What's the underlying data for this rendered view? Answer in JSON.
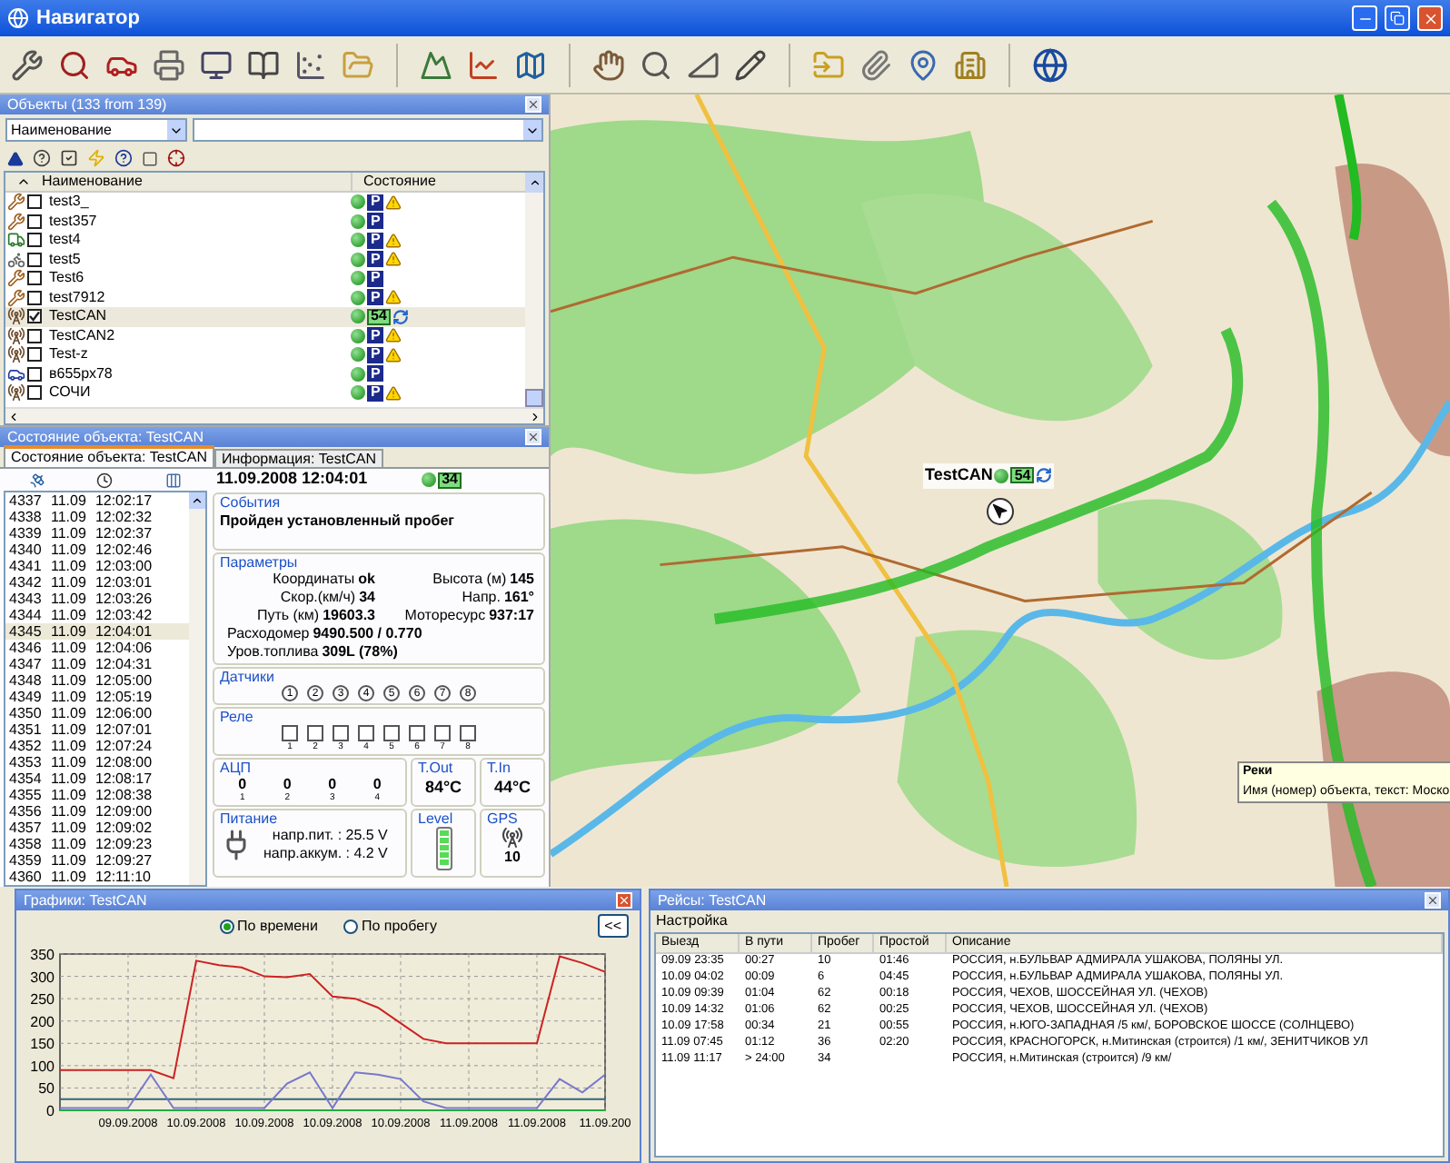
{
  "window": {
    "title": "Навигатор"
  },
  "objects_panel": {
    "title": "Объекты (133 from 139)",
    "filter_field": "Наименование",
    "columns": [
      "Наименование",
      "Состояние"
    ],
    "rows": [
      {
        "kind": "tools",
        "name": "test3_",
        "checked": false,
        "badge": "P",
        "warning": true,
        "refresh": false,
        "selected": false
      },
      {
        "kind": "tools",
        "name": "test357",
        "checked": false,
        "badge": "P",
        "warning": false,
        "refresh": false,
        "selected": false
      },
      {
        "kind": "truck",
        "name": "test4",
        "checked": false,
        "badge": "P",
        "warning": true,
        "refresh": false,
        "selected": false
      },
      {
        "kind": "bike",
        "name": "test5",
        "checked": false,
        "badge": "P",
        "warning": true,
        "refresh": false,
        "selected": false
      },
      {
        "kind": "tools",
        "name": "Test6",
        "checked": false,
        "badge": "P",
        "warning": false,
        "refresh": false,
        "selected": false
      },
      {
        "kind": "tools",
        "name": "test7912",
        "checked": false,
        "badge": "P",
        "warning": true,
        "refresh": false,
        "selected": false
      },
      {
        "kind": "tower",
        "name": "TestCAN",
        "checked": true,
        "badge": "54",
        "warning": false,
        "refresh": true,
        "selected": true
      },
      {
        "kind": "tower",
        "name": "TestCAN2",
        "checked": false,
        "badge": "P",
        "warning": true,
        "refresh": false,
        "selected": false
      },
      {
        "kind": "tower",
        "name": "Test-z",
        "checked": false,
        "badge": "P",
        "warning": true,
        "refresh": false,
        "selected": false
      },
      {
        "kind": "car",
        "name": "в655рх78",
        "checked": false,
        "badge": "P",
        "warning": false,
        "refresh": false,
        "selected": false
      },
      {
        "kind": "tower",
        "name": "СОЧИ",
        "checked": false,
        "badge": "P",
        "warning": true,
        "refresh": false,
        "selected": false
      }
    ]
  },
  "state_panel": {
    "title": "Состояние объекта: TestCAN",
    "tabs": [
      {
        "label": "Состояние объекта: TestCAN",
        "selected": true
      },
      {
        "label": "Информация: TestCAN",
        "selected": false
      }
    ],
    "log": [
      {
        "id": "4337",
        "date": "11.09",
        "time": "12:02:17",
        "selected": false
      },
      {
        "id": "4338",
        "date": "11.09",
        "time": "12:02:32",
        "selected": false
      },
      {
        "id": "4339",
        "date": "11.09",
        "time": "12:02:37",
        "selected": false
      },
      {
        "id": "4340",
        "date": "11.09",
        "time": "12:02:46",
        "selected": false
      },
      {
        "id": "4341",
        "date": "11.09",
        "time": "12:03:00",
        "selected": false
      },
      {
        "id": "4342",
        "date": "11.09",
        "time": "12:03:01",
        "selected": false
      },
      {
        "id": "4343",
        "date": "11.09",
        "time": "12:03:26",
        "selected": false
      },
      {
        "id": "4344",
        "date": "11.09",
        "time": "12:03:42",
        "selected": false
      },
      {
        "id": "4345",
        "date": "11.09",
        "time": "12:04:01",
        "selected": true
      },
      {
        "id": "4346",
        "date": "11.09",
        "time": "12:04:06",
        "selected": false
      },
      {
        "id": "4347",
        "date": "11.09",
        "time": "12:04:31",
        "selected": false
      },
      {
        "id": "4348",
        "date": "11.09",
        "time": "12:05:00",
        "selected": false
      },
      {
        "id": "4349",
        "date": "11.09",
        "time": "12:05:19",
        "selected": false
      },
      {
        "id": "4350",
        "date": "11.09",
        "time": "12:06:00",
        "selected": false
      },
      {
        "id": "4351",
        "date": "11.09",
        "time": "12:07:01",
        "selected": false
      },
      {
        "id": "4352",
        "date": "11.09",
        "time": "12:07:24",
        "selected": false
      },
      {
        "id": "4353",
        "date": "11.09",
        "time": "12:08:00",
        "selected": false
      },
      {
        "id": "4354",
        "date": "11.09",
        "time": "12:08:17",
        "selected": false
      },
      {
        "id": "4355",
        "date": "11.09",
        "time": "12:08:38",
        "selected": false
      },
      {
        "id": "4356",
        "date": "11.09",
        "time": "12:09:00",
        "selected": false
      },
      {
        "id": "4357",
        "date": "11.09",
        "time": "12:09:02",
        "selected": false
      },
      {
        "id": "4358",
        "date": "11.09",
        "time": "12:09:23",
        "selected": false
      },
      {
        "id": "4359",
        "date": "11.09",
        "time": "12:09:27",
        "selected": false
      },
      {
        "id": "4360",
        "date": "11.09",
        "time": "12:11:10",
        "selected": false
      }
    ],
    "timestamp": "11.09.2008 12:04:01",
    "badge": "34",
    "events": {
      "title": "События",
      "text": "Пройден установленный пробег"
    },
    "params": {
      "title": "Параметры",
      "items": [
        {
          "label": "Координаты",
          "value": "ok",
          "wide": false
        },
        {
          "label": "Высота (м)",
          "value": "145",
          "wide": false
        },
        {
          "label": "Скор.(км/ч)",
          "value": "34",
          "wide": false
        },
        {
          "label": "Напр.",
          "value": "161°",
          "wide": false
        },
        {
          "label": "Путь (км)",
          "value": "19603.3",
          "wide": false
        },
        {
          "label": "Моторесурс",
          "value": "937:17",
          "wide": false
        },
        {
          "label": "Расходомер",
          "value": "9490.500 / 0.770",
          "wide": true
        },
        {
          "label": "Уров.топлива",
          "value": "309L (78%)",
          "wide": true
        }
      ]
    },
    "sensors": {
      "title": "Датчики",
      "items": [
        "1",
        "2",
        "3",
        "4",
        "5",
        "6",
        "7",
        "8"
      ]
    },
    "relays": {
      "title": "Реле",
      "items": [
        {
          "label": "1",
          "checked": false
        },
        {
          "label": "2",
          "checked": false
        },
        {
          "label": "3",
          "checked": false
        },
        {
          "label": "4",
          "checked": false
        },
        {
          "label": "5",
          "checked": false
        },
        {
          "label": "6",
          "checked": false
        },
        {
          "label": "7",
          "checked": false
        },
        {
          "label": "8",
          "checked": false
        }
      ]
    },
    "adc": {
      "title": "АЦП",
      "items": [
        {
          "value": "0",
          "index": "1"
        },
        {
          "value": "0",
          "index": "2"
        },
        {
          "value": "0",
          "index": "3"
        },
        {
          "value": "0",
          "index": "4"
        }
      ]
    },
    "t_out": {
      "title": "T.Out",
      "value": "84°C"
    },
    "t_in": {
      "title": "T.In",
      "value": "44°C"
    },
    "power": {
      "title": "Питание",
      "lines": [
        "напр.пит. : 25.5 V",
        "напр.аккум. : 4.2 V"
      ]
    },
    "battery": {
      "title": "Level",
      "level": 1
    },
    "gps": {
      "title": "GPS",
      "value": "10"
    }
  },
  "map": {
    "marker": {
      "label": "TestCAN",
      "badge": "54"
    },
    "tooltip": {
      "title": "Реки",
      "text": "Имя (номер) объекта, текст: Моско"
    }
  },
  "graph_panel": {
    "title": "Графики: TestCAN",
    "modes": [
      {
        "label": "По времени",
        "selected": true
      },
      {
        "label": "По пробегу",
        "selected": false
      }
    ],
    "collapse_button": "<<",
    "chart_data": {
      "type": "line",
      "grid": true,
      "categories": [
        null,
        null,
        null,
        "09.09.2008",
        null,
        null,
        "10.09.2008",
        null,
        null,
        "10.09.2008",
        null,
        null,
        "10.09.2008",
        null,
        null,
        "10.09.2008",
        null,
        null,
        "11.09.2008",
        null,
        null,
        "11.09.2008",
        null,
        null,
        "11.09.200"
      ],
      "ylim": [
        0,
        350
      ],
      "yticks": [
        0,
        50,
        100,
        150,
        200,
        250,
        300,
        350
      ],
      "series": [
        {
          "color": "#22aa44",
          "values": [
            0,
            0,
            0,
            0,
            0,
            0,
            0,
            0,
            0,
            0,
            0,
            0,
            0,
            0,
            0,
            0,
            0,
            0,
            0,
            0,
            0,
            0,
            0,
            0,
            0
          ]
        },
        {
          "color": "#336677",
          "values": [
            25,
            25,
            25,
            25,
            25,
            25,
            25,
            25,
            25,
            25,
            25,
            25,
            25,
            25,
            25,
            25,
            25,
            25,
            25,
            25,
            25,
            25,
            25,
            25,
            25
          ]
        },
        {
          "color": "#cc2222",
          "values": [
            90,
            90,
            90,
            90,
            90,
            72,
            335,
            325,
            320,
            300,
            298,
            305,
            255,
            250,
            230,
            195,
            160,
            150,
            150,
            150,
            150,
            150,
            345,
            330,
            310
          ]
        },
        {
          "color": "#7777cc",
          "values": [
            5,
            5,
            5,
            5,
            80,
            5,
            5,
            5,
            5,
            5,
            60,
            85,
            5,
            85,
            80,
            70,
            20,
            5,
            5,
            5,
            5,
            5,
            70,
            40,
            80
          ]
        }
      ]
    }
  },
  "trips_panel": {
    "title": "Рейсы: TestCAN",
    "menu": [
      "Настройка"
    ],
    "columns": [
      "Выезд",
      "В пути",
      "Пробег",
      "Простой",
      "Описание"
    ],
    "rows": [
      [
        "09.09 23:35",
        "00:27",
        "10",
        "01:46",
        "РОССИЯ, н.БУЛЬВАР АДМИРАЛА УШАКОВА, ПОЛЯНЫ УЛ."
      ],
      [
        "10.09 04:02",
        "00:09",
        "6",
        "04:45",
        "РОССИЯ, н.БУЛЬВАР АДМИРАЛА УШАКОВА, ПОЛЯНЫ УЛ."
      ],
      [
        "10.09 09:39",
        "01:04",
        "62",
        "00:18",
        "РОССИЯ, ЧЕХОВ, ШОССЕЙНАЯ УЛ. (ЧЕХОВ)"
      ],
      [
        "10.09 14:32",
        "01:06",
        "62",
        "00:25",
        "РОССИЯ, ЧЕХОВ, ШОССЕЙНАЯ УЛ. (ЧЕХОВ)"
      ],
      [
        "10.09 17:58",
        "00:34",
        "21",
        "00:55",
        "РОССИЯ, н.ЮГО-ЗАПАДНАЯ /5 км/, БОРОВСКОЕ ШОССЕ (СОЛНЦЕВО)"
      ],
      [
        "11.09 07:45",
        "01:12",
        "36",
        "02:20",
        "РОССИЯ, КРАСНОГОРСК, н.Митинская (строится) /1 км/, ЗЕНИТЧИКОВ УЛ"
      ],
      [
        "11.09 11:17",
        "> 24:00",
        "34",
        "",
        "РОССИЯ, н.Митинская (строится) /9 км/"
      ]
    ]
  }
}
